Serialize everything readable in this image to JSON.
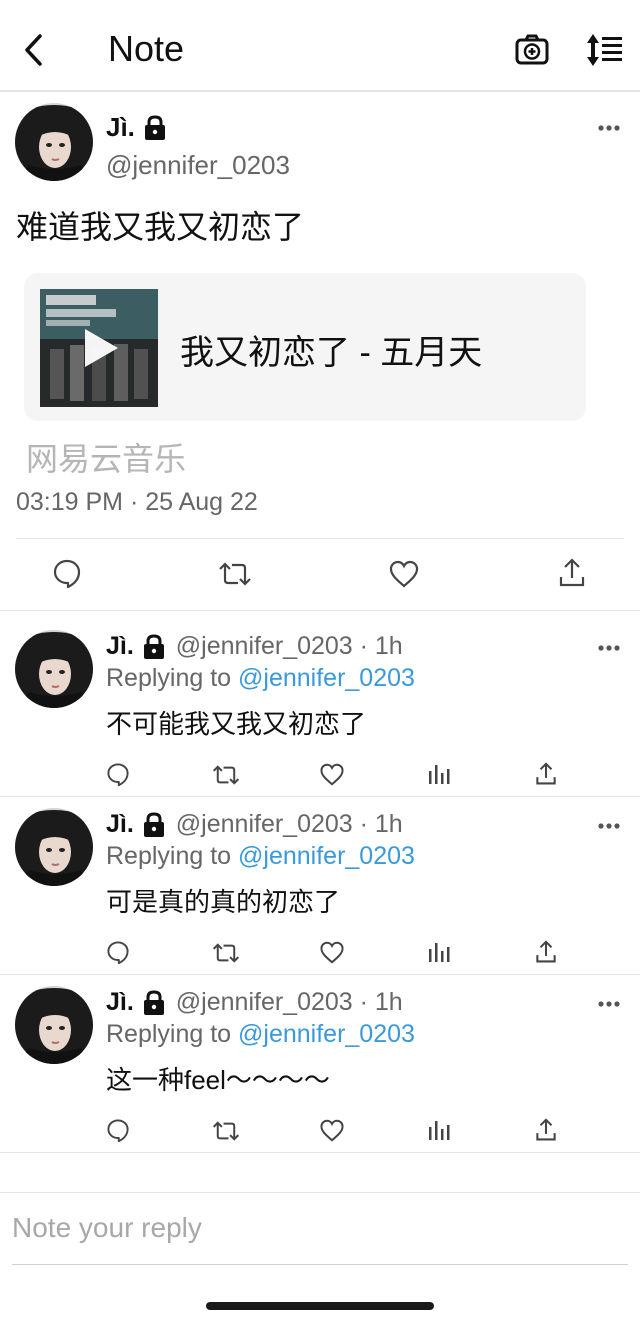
{
  "header": {
    "title": "Note",
    "back_icon": "chevron-left-icon",
    "camera_icon": "camera-plus-icon",
    "sort_icon": "sort-icon"
  },
  "main_post": {
    "name": "Jì.",
    "handle": "@jennifer_0203",
    "text": "难道我又我又初恋了",
    "card": {
      "title": "我又初恋了 - 五月天"
    },
    "source": "网易云音乐",
    "timestamp": "03:19 PM · 25 Aug 22"
  },
  "replies": [
    {
      "name": "Jì.",
      "meta": "@jennifer_0203 · 1h",
      "replying_prefix": "Replying to ",
      "replying_to": "@jennifer_0203",
      "text": "不可能我又我又初恋了"
    },
    {
      "name": "Jì.",
      "meta": "@jennifer_0203 · 1h",
      "replying_prefix": "Replying to ",
      "replying_to": "@jennifer_0203",
      "text": "可是真的真的初恋了"
    },
    {
      "name": "Jì.",
      "meta": "@jennifer_0203 · 1h",
      "replying_prefix": "Replying to ",
      "replying_to": "@jennifer_0203",
      "text": "这一种feel～～～～"
    }
  ],
  "reply_box": {
    "placeholder": "Note your reply"
  },
  "colors": {
    "link": "#3a9ad9",
    "secondary_text": "#666666",
    "separator": "#e4e4e4"
  }
}
